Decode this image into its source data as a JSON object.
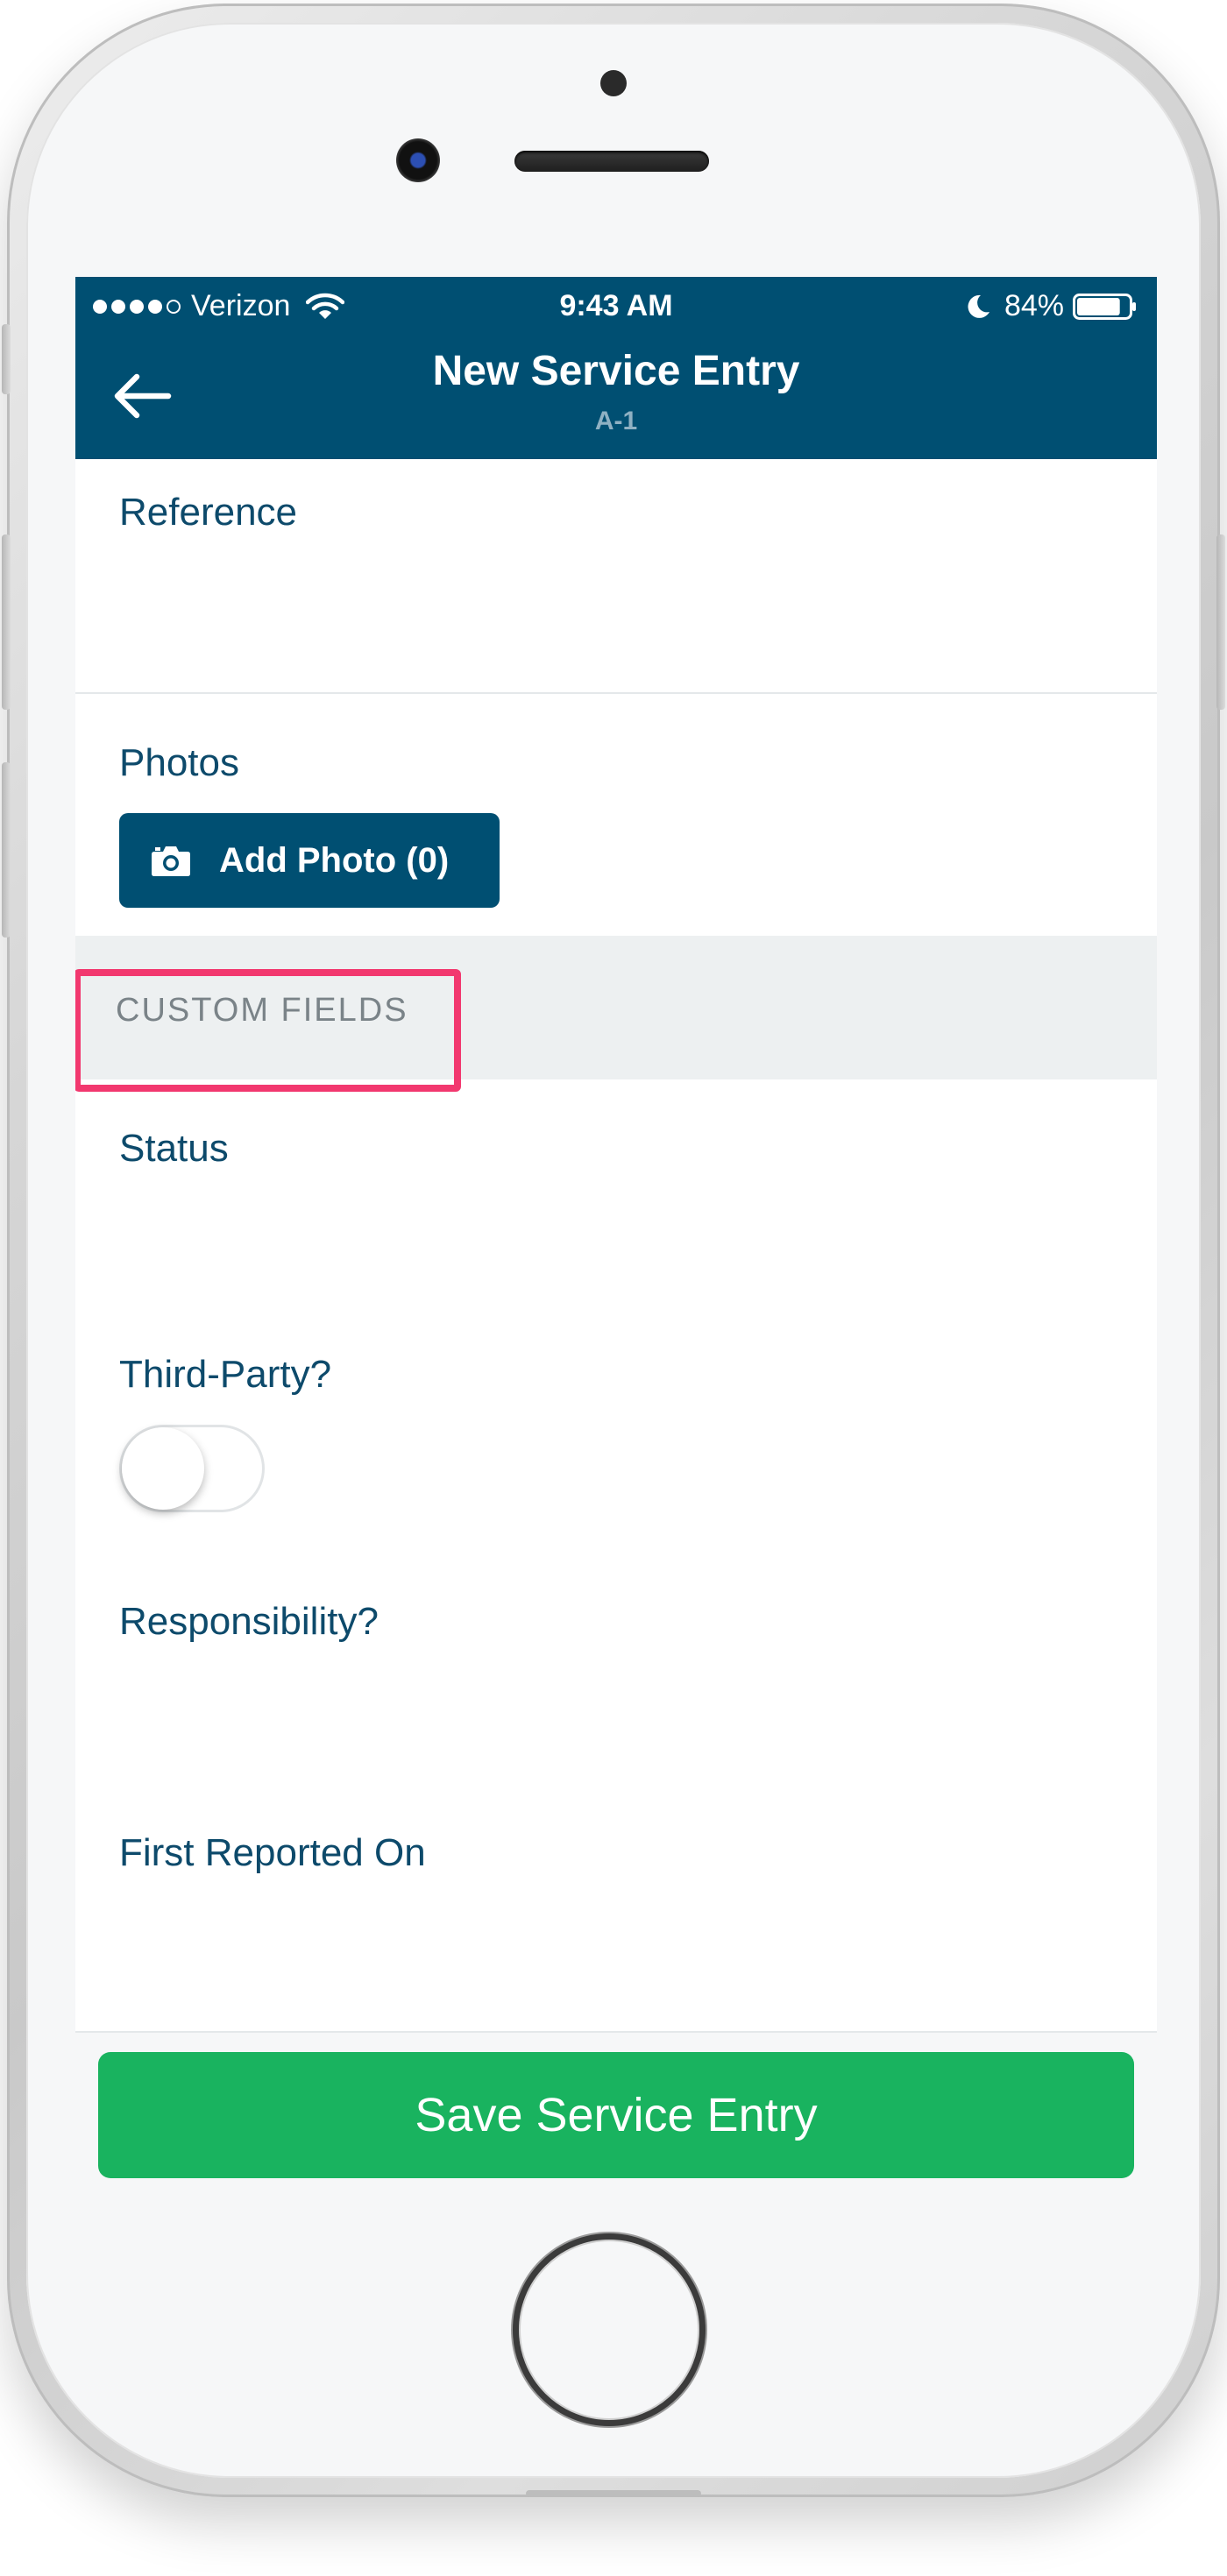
{
  "status_bar": {
    "carrier": "Verizon",
    "signal_bars_filled": 4,
    "signal_bars_total": 5,
    "time": "9:43 AM",
    "battery_percent": "84%",
    "battery_level": 0.84
  },
  "nav": {
    "back_icon": "back-arrow-icon",
    "title": "New Service Entry",
    "subtitle": "A-1"
  },
  "fields": {
    "reference_label": "Reference",
    "photos_label": "Photos",
    "add_photo_label": "Add Photo (0)",
    "add_photo_icon": "camera-icon"
  },
  "custom_fields": {
    "section_label": "CUSTOM FIELDS",
    "highlight_color": "#f2386f",
    "status_label": "Status",
    "third_party_label": "Third-Party?",
    "third_party_toggle_on": false,
    "responsibility_label": "Responsibility?",
    "first_reported_label": "First Reported On"
  },
  "footer": {
    "save_label": "Save Service Entry"
  },
  "colors": {
    "nav_background": "#004f72",
    "label_text": "#0d4a6b",
    "save_button": "#19b35f"
  }
}
